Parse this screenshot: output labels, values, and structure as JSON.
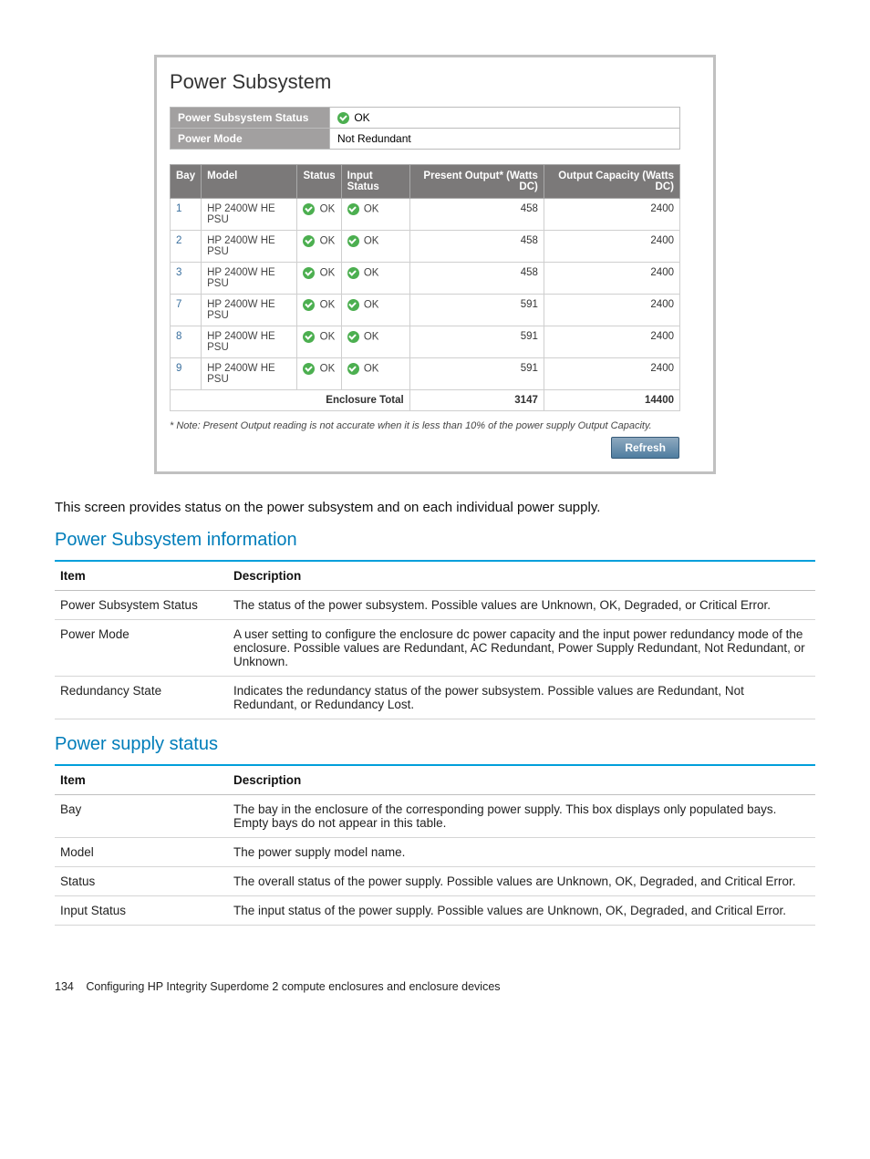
{
  "panel": {
    "title": "Power Subsystem",
    "status_label": "Power Subsystem Status",
    "status_value": "OK",
    "mode_label": "Power Mode",
    "mode_value": "Not Redundant",
    "columns": {
      "bay": "Bay",
      "model": "Model",
      "status": "Status",
      "input_status": "Input Status",
      "present_output": "Present Output* (Watts DC)",
      "output_capacity": "Output Capacity (Watts DC)"
    },
    "rows": [
      {
        "bay": "1",
        "model": "HP 2400W HE PSU",
        "status": "OK",
        "input_status": "OK",
        "present_output": "458",
        "output_capacity": "2400"
      },
      {
        "bay": "2",
        "model": "HP 2400W HE PSU",
        "status": "OK",
        "input_status": "OK",
        "present_output": "458",
        "output_capacity": "2400"
      },
      {
        "bay": "3",
        "model": "HP 2400W HE PSU",
        "status": "OK",
        "input_status": "OK",
        "present_output": "458",
        "output_capacity": "2400"
      },
      {
        "bay": "7",
        "model": "HP 2400W HE PSU",
        "status": "OK",
        "input_status": "OK",
        "present_output": "591",
        "output_capacity": "2400"
      },
      {
        "bay": "8",
        "model": "HP 2400W HE PSU",
        "status": "OK",
        "input_status": "OK",
        "present_output": "591",
        "output_capacity": "2400"
      },
      {
        "bay": "9",
        "model": "HP 2400W HE PSU",
        "status": "OK",
        "input_status": "OK",
        "present_output": "591",
        "output_capacity": "2400"
      }
    ],
    "total_label": "Enclosure Total",
    "total_output": "3147",
    "total_capacity": "14400",
    "note": "* Note: Present Output reading is not accurate when it is less than 10% of the power supply Output Capacity.",
    "refresh": "Refresh"
  },
  "intro": "This screen provides status on the power subsystem and on each individual power supply.",
  "section1": {
    "title": "Power Subsystem information",
    "th_item": "Item",
    "th_desc": "Description",
    "rows": [
      {
        "item": "Power Subsystem Status",
        "desc": "The status of the power subsystem. Possible values are Unknown, OK, Degraded, or Critical Error."
      },
      {
        "item": "Power Mode",
        "desc": "A user setting to configure the enclosure dc power capacity and the input power redundancy mode of the enclosure. Possible values are Redundant, AC Redundant, Power Supply Redundant, Not Redundant, or Unknown."
      },
      {
        "item": "Redundancy State",
        "desc": "Indicates the redundancy status of the power subsystem. Possible values are Redundant, Not Redundant, or Redundancy Lost."
      }
    ]
  },
  "section2": {
    "title": "Power supply status",
    "th_item": "Item",
    "th_desc": "Description",
    "rows": [
      {
        "item": "Bay",
        "desc": "The bay in the enclosure of the corresponding power supply. This box displays only populated bays. Empty bays do not appear in this table."
      },
      {
        "item": "Model",
        "desc": "The power supply model name."
      },
      {
        "item": "Status",
        "desc": "The overall status of the power supply. Possible values are Unknown, OK, Degraded, and Critical Error."
      },
      {
        "item": "Input Status",
        "desc": "The input status of the power supply. Possible values are Unknown, OK, Degraded, and Critical Error."
      }
    ]
  },
  "footer": {
    "page": "134",
    "text": "Configuring HP Integrity Superdome 2 compute enclosures and enclosure devices"
  }
}
